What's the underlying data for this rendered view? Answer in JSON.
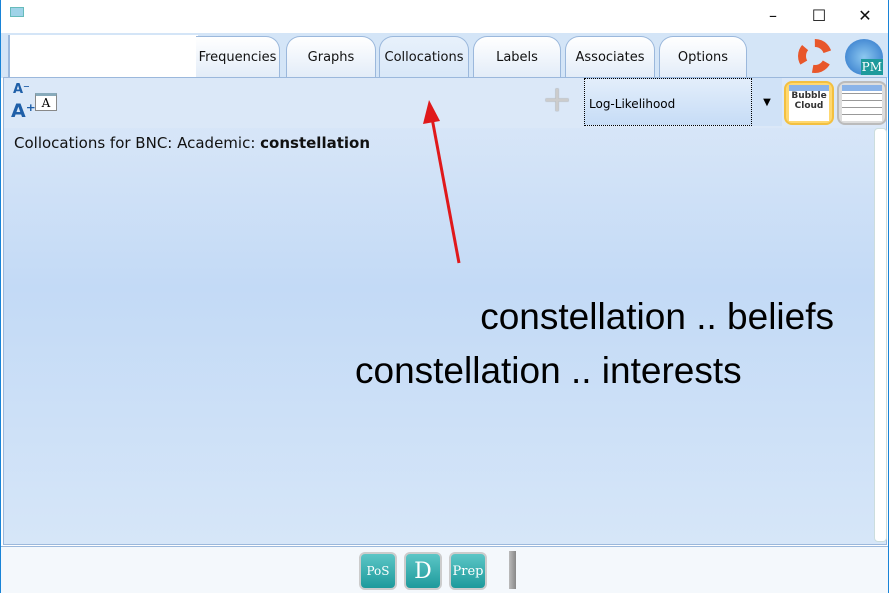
{
  "window": {
    "minimize": "–",
    "maximize": "☐",
    "close": "✕"
  },
  "tabs": [
    {
      "label": "Frequencies"
    },
    {
      "label": "Graphs"
    },
    {
      "label": "Collocations",
      "active": true
    },
    {
      "label": "Labels"
    },
    {
      "label": "Associates"
    },
    {
      "label": "Options"
    }
  ],
  "toolbar": {
    "font_decrease": "A⁻",
    "font_increase": "A⁺",
    "font_dialog": "A",
    "add": "+",
    "measure": "Log-Likelihood",
    "bubble_view": "Bubble Cloud",
    "table_view": "table"
  },
  "heading": {
    "prefix": "Collocations for BNC: Academic: ",
    "word": "constellation"
  },
  "collocations": [
    {
      "text": "constellation .. beliefs"
    },
    {
      "text": "constellation .. interests"
    }
  ],
  "bottom": {
    "pos": "PoS",
    "d": "D",
    "prep": "Prep"
  },
  "colors": {
    "accent": "#1883d7",
    "arrow": "#e0191b",
    "tool_teal": "#1e9a9c"
  }
}
